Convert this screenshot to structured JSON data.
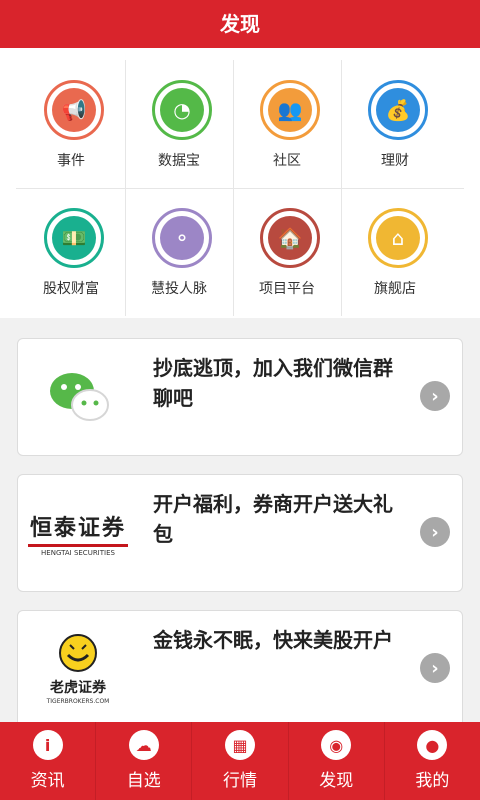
{
  "header": {
    "title": "发现"
  },
  "features": [
    {
      "label": "事件",
      "icon": "megaphone-icon",
      "color": "#e9694f"
    },
    {
      "label": "数据宝",
      "icon": "pie-chart-icon",
      "color": "#54b948"
    },
    {
      "label": "社区",
      "icon": "people-icon",
      "color": "#f39c3b"
    },
    {
      "label": "理财",
      "icon": "money-bag-icon",
      "color": "#2f8ede"
    },
    {
      "label": "股权财富",
      "icon": "cash-hand-icon",
      "color": "#19b08f"
    },
    {
      "label": "慧投人脉",
      "icon": "network-icon",
      "color": "#9c86c6"
    },
    {
      "label": "项目平台",
      "icon": "house-icon",
      "color": "#b84a3f"
    },
    {
      "label": "旗舰店",
      "icon": "flagship-icon",
      "color": "#f0b733"
    }
  ],
  "cards": [
    {
      "title": "抄底逃顶，加入我们微信群聊吧",
      "logo": "wechat-icon"
    },
    {
      "title": "开户福利，券商开户送大礼包",
      "logo_text": "恒泰证券",
      "logo_subtext": "HENGTAI SECURITIES"
    },
    {
      "title": "金钱永不眠，快来美股开户",
      "logo_text": "老虎证券",
      "logo_subtext": "TIGERBROKERS.COM"
    }
  ],
  "bottom_nav": [
    {
      "label": "资讯",
      "icon": "info-icon"
    },
    {
      "label": "自选",
      "icon": "cloud-icon"
    },
    {
      "label": "行情",
      "icon": "grid-icon"
    },
    {
      "label": "发现",
      "icon": "eye-icon"
    },
    {
      "label": "我的",
      "icon": "user-icon"
    }
  ],
  "colors": {
    "brand": "#d9242c",
    "background": "#f1f1f1"
  }
}
